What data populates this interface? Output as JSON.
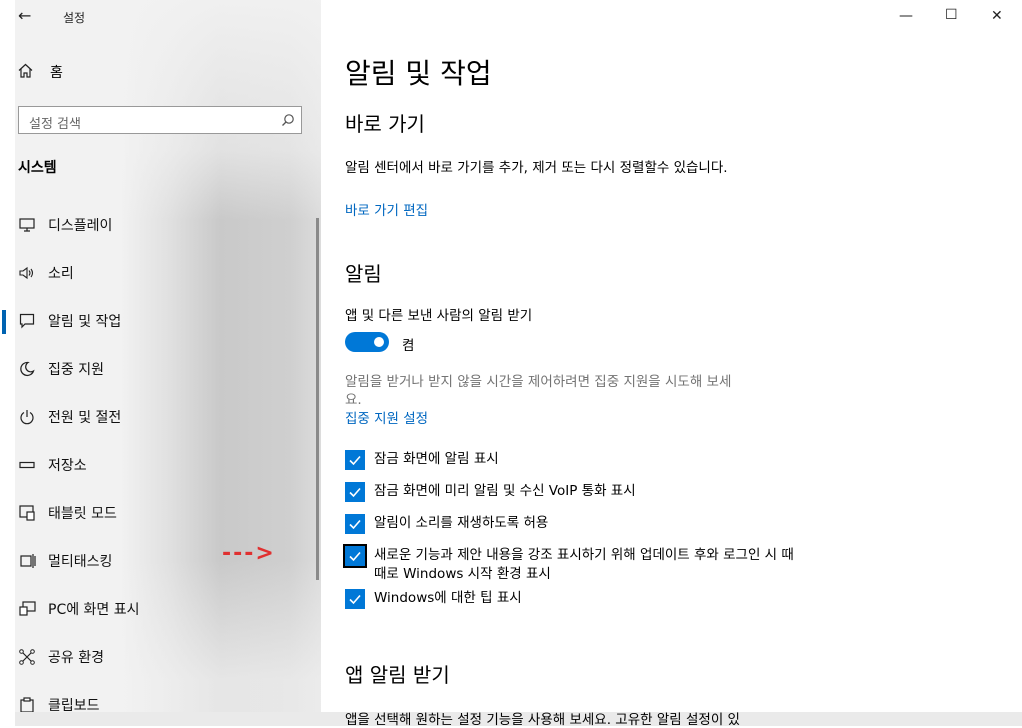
{
  "window": {
    "title": "설정",
    "back_glyph": "←",
    "minimize_glyph": "—",
    "maximize_glyph": "☐",
    "close_glyph": "✕"
  },
  "sidebar": {
    "home_label": "홈",
    "search_placeholder": "설정 검색",
    "section_title": "시스템",
    "items": [
      {
        "label": "디스플레이",
        "icon": "display-icon"
      },
      {
        "label": "소리",
        "icon": "speaker-icon"
      },
      {
        "label": "알림 및 작업",
        "icon": "notification-icon",
        "selected": true
      },
      {
        "label": "집중 지원",
        "icon": "moon-icon"
      },
      {
        "label": "전원 및 절전",
        "icon": "power-icon"
      },
      {
        "label": "저장소",
        "icon": "storage-icon"
      },
      {
        "label": "태블릿 모드",
        "icon": "tablet-icon"
      },
      {
        "label": "멀티태스킹",
        "icon": "multitasking-icon"
      },
      {
        "label": "PC에 화면 표시",
        "icon": "project-icon"
      },
      {
        "label": "공유 환경",
        "icon": "share-icon"
      },
      {
        "label": "클립보드",
        "icon": "clipboard-icon"
      }
    ]
  },
  "annotation": {
    "arrow_text": "--->",
    "color": "#e03030"
  },
  "main": {
    "page_title": "알림 및 작업",
    "shortcuts": {
      "heading": "바로 가기",
      "description": "알림 센터에서 바로 가기를 추가, 제거 또는 다시 정렬할수 있습니다.",
      "edit_link": "바로 가기 편집"
    },
    "notifications": {
      "heading": "알림",
      "toggle_label": "앱 및 다른 보낸 사람의 알림 받기",
      "toggle_state": "켬",
      "focus_hint_line1": "알림을 받거나 받지 않을 시간을 제어하려면 집중 지원을 시도해 보세",
      "focus_hint_line2": "요.",
      "focus_link": "집중 지원 설정",
      "checkboxes": [
        {
          "label": "잠금 화면에 알림 표시",
          "checked": true
        },
        {
          "label": "잠금 화면에 미리 알림 및 수신 VoIP 통화 표시",
          "checked": true
        },
        {
          "label": "알림이 소리를 재생하도록 허용",
          "checked": true
        },
        {
          "label": "새로운 기능과 제안 내용을 강조 표시하기 위해 업데이트 후와 로그인 시 때때로 Windows 시작 환경 표시",
          "checked": true
        },
        {
          "label": "Windows에 대한 팁 표시",
          "checked": true
        }
      ]
    },
    "app_notifications": {
      "heading": "앱 알림 받기",
      "description": "앱을 선택해 원하는 설정 기능을 사용해 보세요. 고유한 알림 설정이 있"
    }
  },
  "colors": {
    "accent": "#0078d7",
    "link": "#0067c0",
    "selection_bar": "#0063b1"
  }
}
